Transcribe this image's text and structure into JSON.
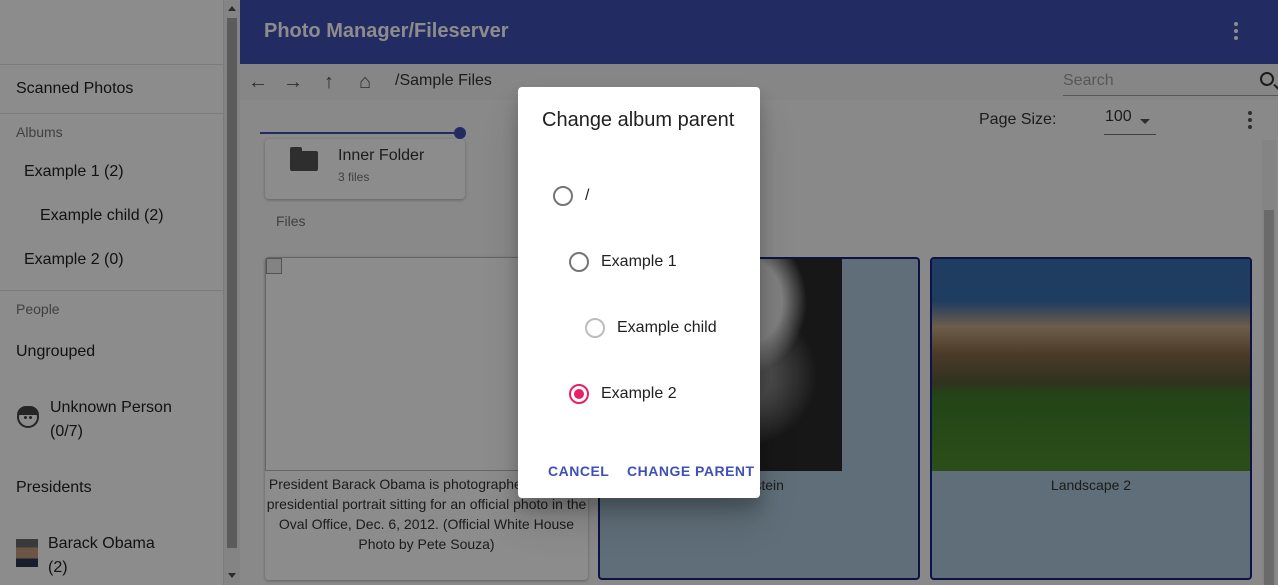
{
  "sidebar": {
    "scanned_photos": "Scanned Photos",
    "albums_heading": "Albums",
    "albums": [
      {
        "label": "Example 1 (2)"
      },
      {
        "label": "Example child (2)"
      },
      {
        "label": "Example 2 (0)"
      }
    ],
    "people_heading": "People",
    "ungrouped": "Ungrouped",
    "unknown_person_name": "Unknown Person",
    "unknown_person_count": "(0/7)",
    "presidents": "Presidents",
    "barack_name": "Barack Obama",
    "barack_count": "(2)"
  },
  "appbar": {
    "title": "Photo Manager/Fileserver",
    "color": "#3f51b5"
  },
  "toolbar": {
    "icons": [
      "arrow-back-icon",
      "arrow-forward-icon",
      "arrow-up-icon",
      "home-icon"
    ],
    "path": "/Sample Files",
    "search_placeholder": "Search"
  },
  "content": {
    "page_size_label": "Page Size:",
    "page_size_value": "100",
    "folder": {
      "name": "Inner Folder",
      "count": "3 files"
    },
    "files_heading": "Files",
    "photos": [
      {
        "caption": "President Barack Obama is photographed during a presidential portrait sitting for an official photo in the Oval Office, Dec. 6, 2012. (Official White House Photo by Pete Souza)"
      },
      {
        "caption": "Einstein"
      },
      {
        "caption": "Landscape 2"
      }
    ]
  },
  "dialog": {
    "title": "Change album parent",
    "options": [
      {
        "label": "/",
        "checked": false
      },
      {
        "label": "Example 1",
        "checked": false
      },
      {
        "label": "Example child",
        "checked": false
      },
      {
        "label": "Example 2",
        "checked": true
      }
    ],
    "cancel_label": "Cancel",
    "confirm_label": "Change parent",
    "accent_color": "#e91e63"
  }
}
